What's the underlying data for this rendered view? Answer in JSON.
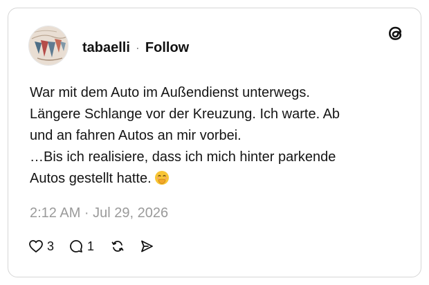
{
  "post": {
    "username": "tabaelli",
    "separator": "·",
    "follow_label": "Follow",
    "text_lines": [
      "War mit dem Auto im Außendienst unterwegs.",
      "Längere Schlange vor der Kreuzung. Ich warte. Ab",
      "und an fahren Autos an mir vorbei.",
      "…Bis ich realisiere, dass ich mich hinter parkende",
      "Autos gestellt hatte."
    ],
    "emoji": "face-with-hand-over-mouth-icon",
    "timestamp": "2:12 AM · Jul 29, 2026",
    "likes": "3",
    "replies": "1"
  },
  "icons": {
    "brand": "threads-logo-icon",
    "like": "heart-icon",
    "reply": "speech-bubble-icon",
    "repost": "repost-icon",
    "share": "send-icon"
  },
  "colors": {
    "text": "#141414",
    "muted": "#9a9a9a",
    "border": "#d6d6d6"
  }
}
